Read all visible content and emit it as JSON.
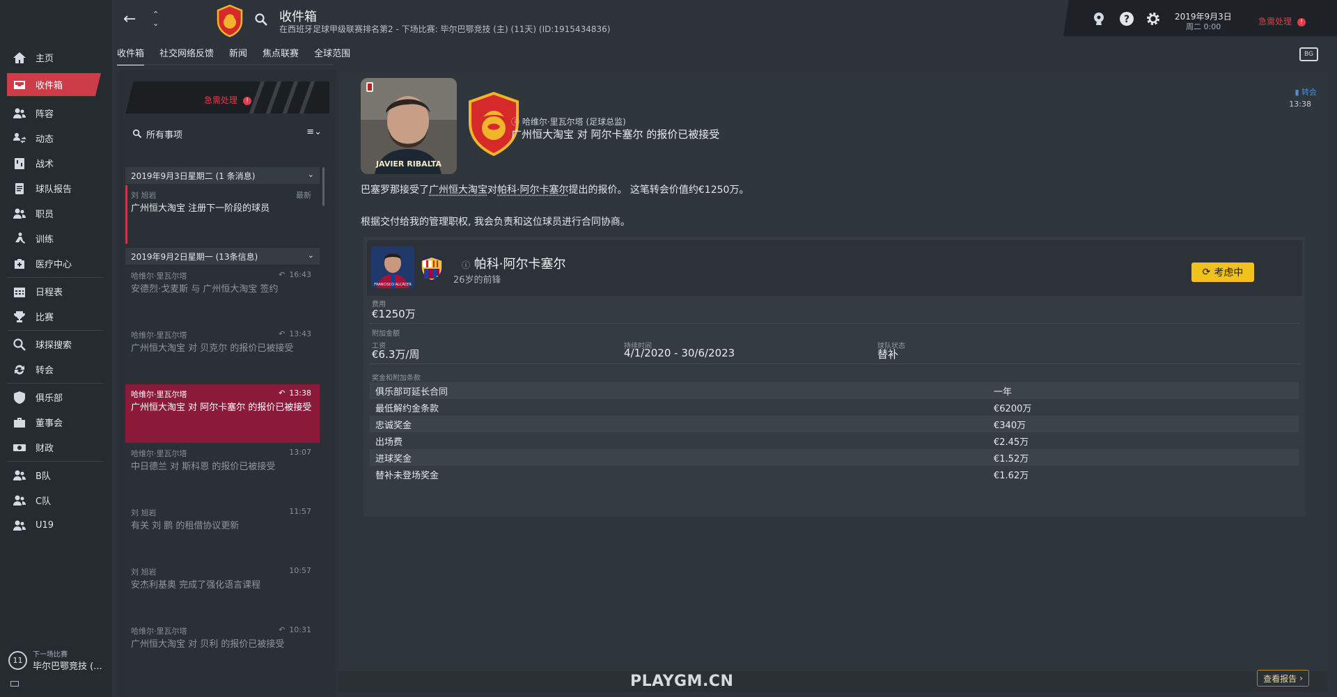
{
  "sidebar": {
    "items": [
      {
        "label": "主页",
        "icon": "home-icon"
      },
      {
        "label": "收件箱",
        "icon": "inbox-icon"
      },
      {
        "label": "阵容",
        "icon": "squad-icon"
      },
      {
        "label": "动态",
        "icon": "dynamics-icon"
      },
      {
        "label": "战术",
        "icon": "tactics-icon"
      },
      {
        "label": "球队报告",
        "icon": "report-icon"
      },
      {
        "label": "职员",
        "icon": "staff-icon"
      },
      {
        "label": "训练",
        "icon": "training-icon"
      },
      {
        "label": "医疗中心",
        "icon": "medical-icon"
      },
      {
        "label": "日程表",
        "icon": "calendar-icon"
      },
      {
        "label": "比赛",
        "icon": "trophy-icon"
      },
      {
        "label": "球探搜索",
        "icon": "search-icon"
      },
      {
        "label": "转会",
        "icon": "transfer-icon"
      },
      {
        "label": "俱乐部",
        "icon": "club-icon"
      },
      {
        "label": "董事会",
        "icon": "board-icon"
      },
      {
        "label": "财政",
        "icon": "finance-icon"
      },
      {
        "label": "B队",
        "icon": "team-b-icon"
      },
      {
        "label": "C队",
        "icon": "team-c-icon"
      },
      {
        "label": "U19",
        "icon": "u19-icon"
      }
    ],
    "next_match": {
      "number": "11",
      "label": "下一场比赛",
      "team": "毕尔巴鄂竞技 (..."
    }
  },
  "header": {
    "title": "收件箱",
    "subtitle": "在西班牙足球甲级联赛排名第2 - 下场比赛: 毕尔巴鄂竞技 (主) (11天) (ID:1915434836)",
    "date": "2019年9月3日",
    "day_time": "周二 0:00",
    "urgent": "急需处理",
    "urgent_mark": "!"
  },
  "tabs": [
    "收件箱",
    "社交网络反馈",
    "新闻",
    "焦点联赛",
    "全球范围"
  ],
  "inbox": {
    "urgent_label": "急需处理",
    "filter_label": "所有事项",
    "groups": [
      {
        "label": "2019年9月3日星期二 (1 条消息)"
      },
      {
        "label": "2019年9月2日星期一 (13条信息)"
      }
    ],
    "messages": [
      {
        "from": "刘 旭岩",
        "time": "最新",
        "subject": "广州恒大淘宝 注册下一阶段的球员"
      },
      {
        "from": "哈维尔·里瓦尔塔",
        "time": "16:43",
        "subject": "安德烈·戈麦斯 与 广州恒大淘宝 签约"
      },
      {
        "from": "哈维尔·里瓦尔塔",
        "time": "13:43",
        "subject": "广州恒大淘宝 对 贝克尔 的报价已被接受"
      },
      {
        "from": "哈维尔·里瓦尔塔",
        "time": "13:38",
        "subject": "广州恒大淘宝 对 阿尔卡塞尔 的报价已被接受"
      },
      {
        "from": "哈维尔·里瓦尔塔",
        "time": "13:07",
        "subject": "中日德兰 对 斯科恩 的报价已被接受"
      },
      {
        "from": "刘 旭岩",
        "time": "11:57",
        "subject": "有关 刘 鹏 的租借协议更新"
      },
      {
        "from": "刘 旭岩",
        "time": "10:57",
        "subject": "安杰利基奥 完成了强化语言课程"
      },
      {
        "from": "哈维尔·里瓦尔塔",
        "time": "10:31",
        "subject": "广州恒大淘宝 对 贝利 的报价已被接受"
      }
    ]
  },
  "detail": {
    "photo_caption": "JAVIER RIBALTA",
    "sender": "哈维尔·里瓦尔塔 (足球总监)",
    "headline": "广州恒大淘宝 对 阿尔卡塞尔 的报价已被接受",
    "category": "转会",
    "time": "13:38",
    "body1_a": "巴塞罗那接受了",
    "body1_u1": "广州恒大淘宝",
    "body1_b": "对",
    "body1_u2": "帕科·阿尔卡塞尔",
    "body1_c": "提出的报价。 这笔转会价值约€1250万。",
    "body2": "根据交付给我的管理职权, 我会负责和这位球员进行合同协商。",
    "player": {
      "name": "帕科·阿尔卡塞尔",
      "desc": "26岁的前锋",
      "photo_caption": "FRANCISCO ALCÁCER",
      "status_button": "考虑中"
    },
    "fee_label": "费用",
    "fee_value": "€1250万",
    "addons_label": "附加金额",
    "wage_label": "工资",
    "wage_value": "€6.3万/周",
    "duration_label": "持续时间",
    "duration_value": "4/1/2020 - 30/6/2023",
    "squad_status_label": "球队状态",
    "squad_status_value": "替补",
    "bonus_label": "奖金和附加条款",
    "bonuses": [
      {
        "k": "俱乐部可延长合同",
        "v": "一年"
      },
      {
        "k": "最低解约金条款",
        "v": "€6200万"
      },
      {
        "k": "忠诚奖金",
        "v": "€340万"
      },
      {
        "k": "出场费",
        "v": "€2.45万"
      },
      {
        "k": "进球奖金",
        "v": "€1.52万"
      },
      {
        "k": "替补未登场奖金",
        "v": "€1.62万"
      }
    ],
    "view_report": "查看报告"
  },
  "screen_badge": "BG",
  "watermark": "PLAYGM.CN",
  "colors": {
    "accent": "#cd3d49",
    "selected": "#8b1a3b",
    "warning": "#f1c21b",
    "link": "#4e8fd4"
  }
}
